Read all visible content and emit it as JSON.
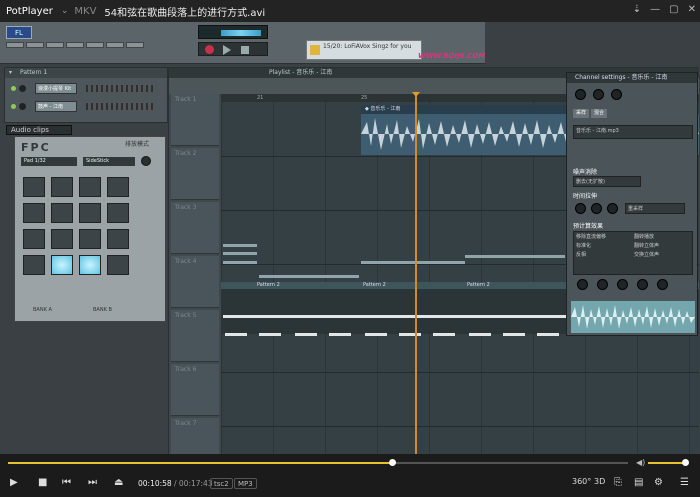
{
  "titlebar": {
    "app_name": "PotPlayer",
    "format": "MKV",
    "file_name": "54和弦在歌曲段落上的进行方式.avi",
    "controls": [
      "⇣",
      "—",
      "▢",
      "✕"
    ]
  },
  "fl": {
    "logo": "FL",
    "banner_text": "15/20: LoFiAVox Singz for you",
    "watermark": "WWW.BQIJ6.COM"
  },
  "rack": {
    "title": "Pattern 1",
    "channels": [
      "浪漫小提琴 Kit",
      "鼓声 - 江南"
    ]
  },
  "audio_clips_label": "Audio clips",
  "fpc": {
    "title": "FPC",
    "mode": "排放模式",
    "pad_select": "Pad 1/32",
    "kit_name": "SideStick",
    "bank_a": "BANK A",
    "bank_b": "BANK B"
  },
  "playlist": {
    "title": "Playlist - 音乐乐 - 江南",
    "ruler": [
      "21",
      "25"
    ],
    "tracks": [
      "Track 1",
      "Track 2",
      "Track 3",
      "Track 4",
      "Track 5",
      "Track 6",
      "Track 7"
    ],
    "clip_title": "◆ 音乐乐 - 江南",
    "pattern_labels": [
      "Pattern 2",
      "Pattern 2",
      "Pattern 2"
    ]
  },
  "channel_settings": {
    "title": "Channel settings - 音乐乐 - 江南",
    "tabs": [
      "采样",
      "混合"
    ],
    "file_name": "音乐乐 - 江南.mp3",
    "sec_noise": "噪声消除",
    "noise_value": "删去(无扩散)",
    "sec_time": "时间拉伸",
    "time_value": "重采样",
    "sec_precomp": "预计算效果",
    "precomp_items": [
      "移除直流偏移",
      "标准化",
      "反相",
      "翻转播放",
      "翻转立体声",
      "交换立体声"
    ]
  },
  "player": {
    "current_time": "00:10:58",
    "total_time": "/ 00:17:43",
    "tags": [
      "tsc2",
      "MP3"
    ],
    "progress": 0.619,
    "volume": 0.85,
    "right_buttons": [
      "360°",
      "3D",
      "⎘",
      "▤",
      "⚙",
      "☰"
    ]
  }
}
